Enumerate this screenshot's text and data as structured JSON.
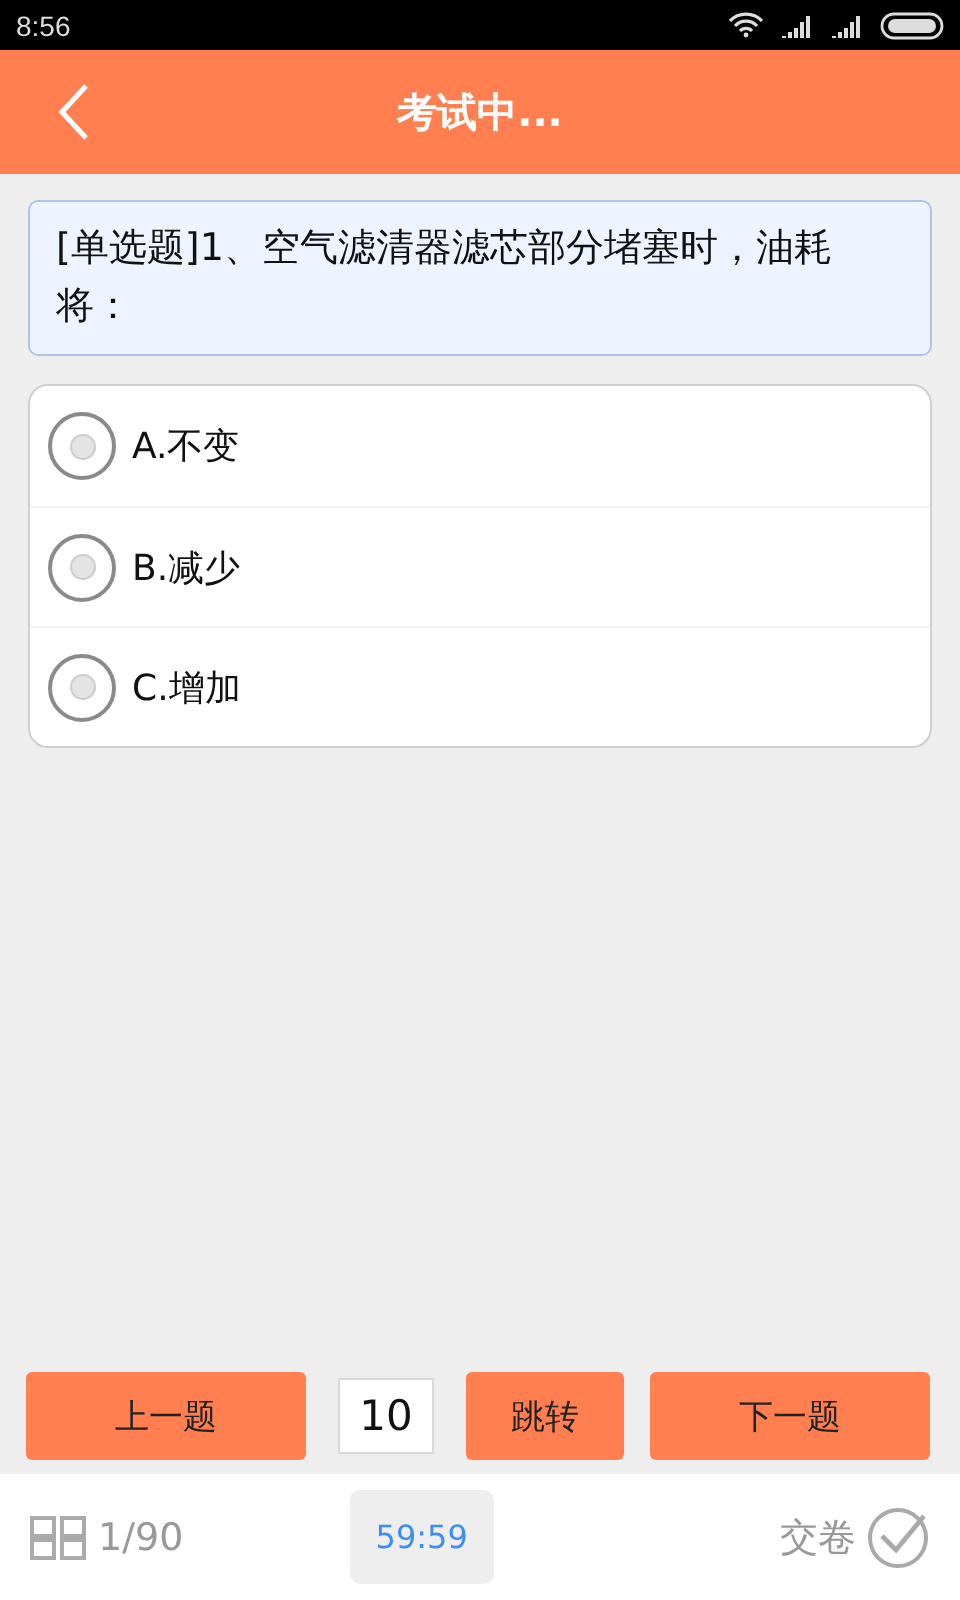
{
  "status_bar": {
    "time": "8:56"
  },
  "header": {
    "title": "考试中..."
  },
  "question": {
    "text": "[单选题]1、空气滤清器滤芯部分堵塞时，油耗将："
  },
  "options": [
    {
      "label": "A.不变",
      "selected": false
    },
    {
      "label": "B.减少",
      "selected": false
    },
    {
      "label": "C.增加",
      "selected": false
    }
  ],
  "navigation": {
    "previous": "上一题",
    "jump_field": {
      "value": "10"
    },
    "jump": "跳转",
    "next": "下一题"
  },
  "footer": {
    "progress": "1/90",
    "timer": "59:59",
    "submit": "交卷"
  }
}
